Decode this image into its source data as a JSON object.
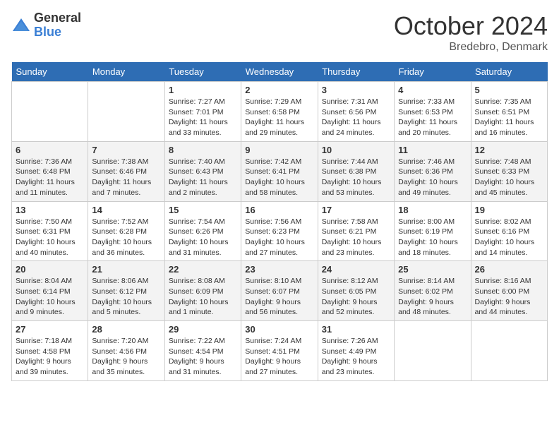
{
  "logo": {
    "general": "General",
    "blue": "Blue"
  },
  "title": "October 2024",
  "location": "Bredebro, Denmark",
  "days_of_week": [
    "Sunday",
    "Monday",
    "Tuesday",
    "Wednesday",
    "Thursday",
    "Friday",
    "Saturday"
  ],
  "weeks": [
    [
      {
        "day": "",
        "detail": ""
      },
      {
        "day": "",
        "detail": ""
      },
      {
        "day": "1",
        "detail": "Sunrise: 7:27 AM\nSunset: 7:01 PM\nDaylight: 11 hours\nand 33 minutes."
      },
      {
        "day": "2",
        "detail": "Sunrise: 7:29 AM\nSunset: 6:58 PM\nDaylight: 11 hours\nand 29 minutes."
      },
      {
        "day": "3",
        "detail": "Sunrise: 7:31 AM\nSunset: 6:56 PM\nDaylight: 11 hours\nand 24 minutes."
      },
      {
        "day": "4",
        "detail": "Sunrise: 7:33 AM\nSunset: 6:53 PM\nDaylight: 11 hours\nand 20 minutes."
      },
      {
        "day": "5",
        "detail": "Sunrise: 7:35 AM\nSunset: 6:51 PM\nDaylight: 11 hours\nand 16 minutes."
      }
    ],
    [
      {
        "day": "6",
        "detail": "Sunrise: 7:36 AM\nSunset: 6:48 PM\nDaylight: 11 hours\nand 11 minutes."
      },
      {
        "day": "7",
        "detail": "Sunrise: 7:38 AM\nSunset: 6:46 PM\nDaylight: 11 hours\nand 7 minutes."
      },
      {
        "day": "8",
        "detail": "Sunrise: 7:40 AM\nSunset: 6:43 PM\nDaylight: 11 hours\nand 2 minutes."
      },
      {
        "day": "9",
        "detail": "Sunrise: 7:42 AM\nSunset: 6:41 PM\nDaylight: 10 hours\nand 58 minutes."
      },
      {
        "day": "10",
        "detail": "Sunrise: 7:44 AM\nSunset: 6:38 PM\nDaylight: 10 hours\nand 53 minutes."
      },
      {
        "day": "11",
        "detail": "Sunrise: 7:46 AM\nSunset: 6:36 PM\nDaylight: 10 hours\nand 49 minutes."
      },
      {
        "day": "12",
        "detail": "Sunrise: 7:48 AM\nSunset: 6:33 PM\nDaylight: 10 hours\nand 45 minutes."
      }
    ],
    [
      {
        "day": "13",
        "detail": "Sunrise: 7:50 AM\nSunset: 6:31 PM\nDaylight: 10 hours\nand 40 minutes."
      },
      {
        "day": "14",
        "detail": "Sunrise: 7:52 AM\nSunset: 6:28 PM\nDaylight: 10 hours\nand 36 minutes."
      },
      {
        "day": "15",
        "detail": "Sunrise: 7:54 AM\nSunset: 6:26 PM\nDaylight: 10 hours\nand 31 minutes."
      },
      {
        "day": "16",
        "detail": "Sunrise: 7:56 AM\nSunset: 6:23 PM\nDaylight: 10 hours\nand 27 minutes."
      },
      {
        "day": "17",
        "detail": "Sunrise: 7:58 AM\nSunset: 6:21 PM\nDaylight: 10 hours\nand 23 minutes."
      },
      {
        "day": "18",
        "detail": "Sunrise: 8:00 AM\nSunset: 6:19 PM\nDaylight: 10 hours\nand 18 minutes."
      },
      {
        "day": "19",
        "detail": "Sunrise: 8:02 AM\nSunset: 6:16 PM\nDaylight: 10 hours\nand 14 minutes."
      }
    ],
    [
      {
        "day": "20",
        "detail": "Sunrise: 8:04 AM\nSunset: 6:14 PM\nDaylight: 10 hours\nand 9 minutes."
      },
      {
        "day": "21",
        "detail": "Sunrise: 8:06 AM\nSunset: 6:12 PM\nDaylight: 10 hours\nand 5 minutes."
      },
      {
        "day": "22",
        "detail": "Sunrise: 8:08 AM\nSunset: 6:09 PM\nDaylight: 10 hours\nand 1 minute."
      },
      {
        "day": "23",
        "detail": "Sunrise: 8:10 AM\nSunset: 6:07 PM\nDaylight: 9 hours\nand 56 minutes."
      },
      {
        "day": "24",
        "detail": "Sunrise: 8:12 AM\nSunset: 6:05 PM\nDaylight: 9 hours\nand 52 minutes."
      },
      {
        "day": "25",
        "detail": "Sunrise: 8:14 AM\nSunset: 6:02 PM\nDaylight: 9 hours\nand 48 minutes."
      },
      {
        "day": "26",
        "detail": "Sunrise: 8:16 AM\nSunset: 6:00 PM\nDaylight: 9 hours\nand 44 minutes."
      }
    ],
    [
      {
        "day": "27",
        "detail": "Sunrise: 7:18 AM\nSunset: 4:58 PM\nDaylight: 9 hours\nand 39 minutes."
      },
      {
        "day": "28",
        "detail": "Sunrise: 7:20 AM\nSunset: 4:56 PM\nDaylight: 9 hours\nand 35 minutes."
      },
      {
        "day": "29",
        "detail": "Sunrise: 7:22 AM\nSunset: 4:54 PM\nDaylight: 9 hours\nand 31 minutes."
      },
      {
        "day": "30",
        "detail": "Sunrise: 7:24 AM\nSunset: 4:51 PM\nDaylight: 9 hours\nand 27 minutes."
      },
      {
        "day": "31",
        "detail": "Sunrise: 7:26 AM\nSunset: 4:49 PM\nDaylight: 9 hours\nand 23 minutes."
      },
      {
        "day": "",
        "detail": ""
      },
      {
        "day": "",
        "detail": ""
      }
    ]
  ]
}
